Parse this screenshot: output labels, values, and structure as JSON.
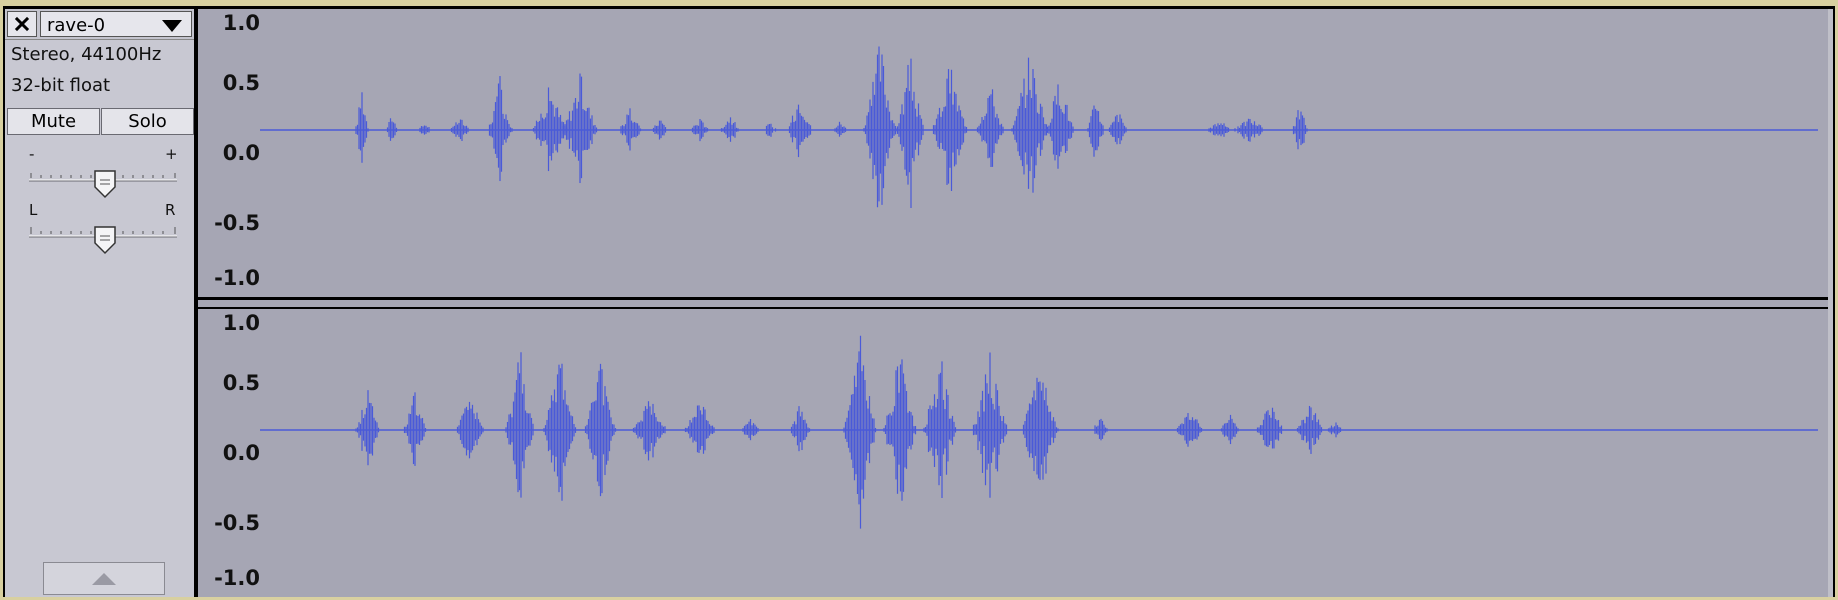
{
  "track": {
    "name": "rave-0",
    "info_format": "Stereo, 44100Hz",
    "info_bits": "32-bit float",
    "mute_label": "Mute",
    "solo_label": "Solo",
    "gain": {
      "minus": "-",
      "plus": "+",
      "value": 0.5
    },
    "pan": {
      "left": "L",
      "right": "R",
      "value": 0.5
    }
  },
  "ruler": {
    "labels": [
      "1.0",
      "0.5",
      "0.0",
      "-0.5",
      "-1.0"
    ]
  },
  "colors": {
    "waveform": "#4a5ad8",
    "background": "#a6a6b4",
    "panel": "#c8c8d2"
  },
  "icons": {
    "close": "close-icon",
    "dropdown": "triangle-down-icon",
    "collapse": "triangle-up-icon",
    "slider_thumb": "slider-thumb-icon"
  }
}
